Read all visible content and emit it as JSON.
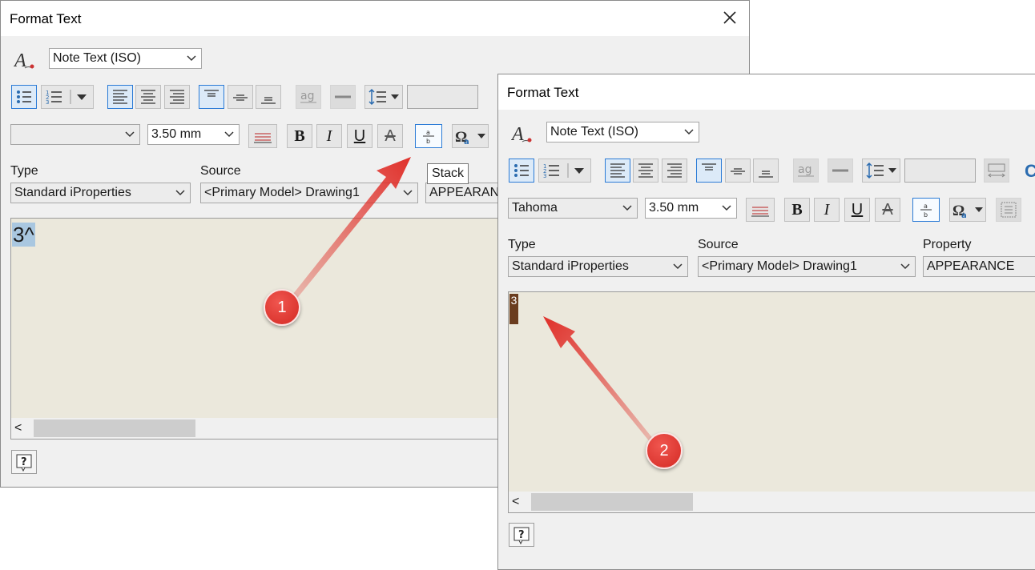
{
  "dialog1": {
    "title": "Format Text",
    "style_combo": "Note Text (ISO)",
    "font_combo": "",
    "size_combo": "3.50 mm",
    "type_label": "Type",
    "type_value": "Standard iProperties",
    "source_label": "Source",
    "source_value": "<Primary Model> Drawing1",
    "property_value": "APPEARANC",
    "editor_text": "3^",
    "tooltip": "Stack"
  },
  "dialog2": {
    "title": "Format Text",
    "style_combo": "Note Text (ISO)",
    "font_combo": "Tahoma",
    "size_combo": "3.50 mm",
    "type_label": "Type",
    "type_value": "Standard iProperties",
    "source_label": "Source",
    "source_value": "<Primary Model> Drawing1",
    "property_label": "Property",
    "property_value": "APPEARANCE",
    "editor_text": "3"
  },
  "toolbar": {
    "bold": "B",
    "italic": "I",
    "underline": "U",
    "strike": "A",
    "stack_glyph_top": "a",
    "stack_glyph_bottom": "b",
    "case_glyph": "ag"
  },
  "callouts": [
    "1",
    "2"
  ],
  "colors": {
    "accent": "#2b7bd6",
    "callout_red": "#e0302a",
    "editor_bg": "#ebe8dc"
  },
  "icons": [
    "text-style-icon",
    "bullet-list-icon",
    "numbered-list-icon",
    "align-left-icon",
    "align-center-icon",
    "align-right-icon",
    "align-top-icon",
    "align-middle-icon",
    "align-bottom-icon",
    "line-spacing-icon",
    "color-icon",
    "symbol-icon",
    "stack-icon",
    "help-icon",
    "close-icon"
  ]
}
